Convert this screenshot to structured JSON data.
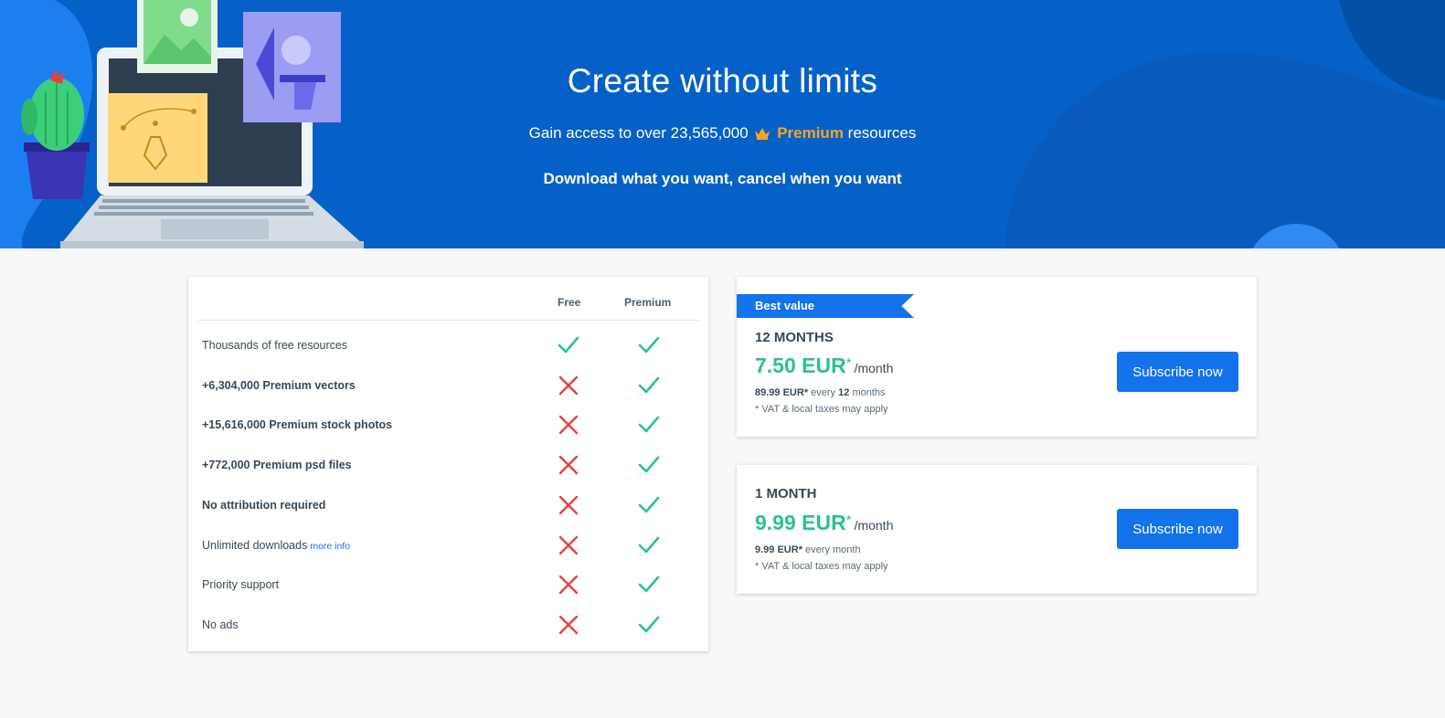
{
  "hero": {
    "title": "Create without limits",
    "subtitle_prefix": "Gain access to over 23,565,000",
    "subtitle_premium": "Premium",
    "subtitle_suffix": "resources",
    "tagline": "Download what you want, cancel when you want"
  },
  "features": {
    "col_free": "Free",
    "col_premium": "Premium",
    "more_info": "more info",
    "rows": [
      {
        "label": "Thousands of free resources",
        "bold": false,
        "free": true,
        "premium": true
      },
      {
        "label": "+6,304,000 Premium vectors",
        "bold": true,
        "free": false,
        "premium": true
      },
      {
        "label": "+15,616,000 Premium stock photos",
        "bold": true,
        "free": false,
        "premium": true
      },
      {
        "label": "+772,000 Premium psd files",
        "bold": true,
        "free": false,
        "premium": true
      },
      {
        "label": "No attribution required",
        "bold": true,
        "free": false,
        "premium": true
      },
      {
        "label": "Unlimited downloads",
        "bold": false,
        "free": false,
        "premium": true
      },
      {
        "label": "Priority support",
        "bold": false,
        "free": false,
        "premium": true
      },
      {
        "label": "No ads",
        "bold": false,
        "free": false,
        "premium": true
      }
    ]
  },
  "plans": [
    {
      "badge": "Best value",
      "name": "12 MONTHS",
      "price": "7.50 EUR",
      "asterisk": "*",
      "per": "/month",
      "billing_amount": "89.99 EUR",
      "billing_asterisk": "*",
      "billing_every": "every",
      "billing_count": "12",
      "billing_unit": "months",
      "vat": "* VAT & local taxes may apply",
      "button": "Subscribe now"
    },
    {
      "name": "1 MONTH",
      "price": "9.99 EUR",
      "asterisk": "*",
      "per": "/month",
      "billing_amount": "9.99 EUR",
      "billing_asterisk": "*",
      "billing_rest": "every month",
      "vat": "* VAT & local taxes may apply",
      "button": "Subscribe now"
    }
  ],
  "colors": {
    "hero_bg": "#0561c7",
    "accent_blue": "#1273eb",
    "premium_orange": "#f5a623",
    "price_green": "#2ec08b",
    "check_green": "#2ec08b",
    "cross_red": "#e8403d"
  },
  "icons": {
    "check": "check-icon",
    "cross": "cross-icon",
    "crown": "crown-icon"
  }
}
